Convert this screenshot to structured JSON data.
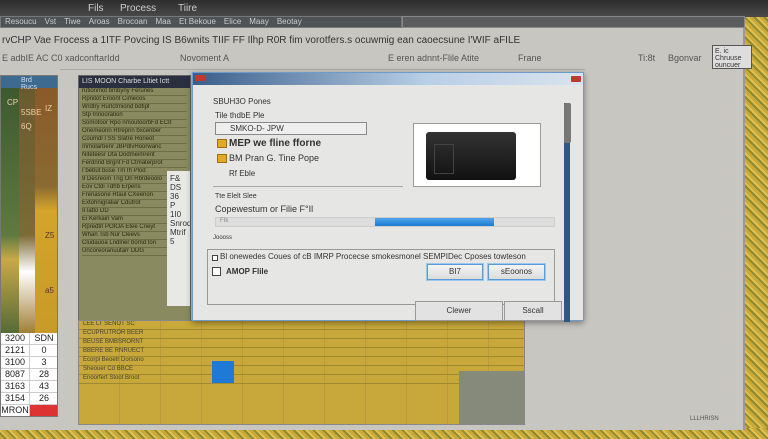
{
  "menu": {
    "items": [
      "Fils",
      "Process",
      "Tiire"
    ]
  },
  "toolbar": {
    "items": [
      "Resoucu",
      "Vst",
      "Tiwe",
      "Aroas",
      "Brocoan",
      "Maa",
      "Et Bekoue",
      "Elice",
      "Maay",
      "Beotay"
    ]
  },
  "header": {
    "title": "rvCHP Vae Frocess a 1ITF Povcing IS B6wnits TIIF FF Ilhp R0R fim vorotfers.s ocuwmig ean caoecsune I'WIF aFILE",
    "row": [
      "E adbIE AC C0 xadconftarIdd",
      "Novoment A",
      "E  eren adnnt-Flile  Atite",
      "Frane",
      "Ti:8t",
      "Bgonvar"
    ],
    "box_text": "E. ic Chruuse ouncuer tesclea"
  },
  "left_panel": {
    "head": "Brd Rucs",
    "cells": [
      "CP",
      "5SBE",
      "IZ",
      "6Q",
      "Z5",
      "a5"
    ],
    "table": [
      [
        "3200",
        "SDN"
      ],
      [
        "2121",
        "0"
      ],
      [
        "3100",
        "3"
      ],
      [
        "8087",
        "28"
      ],
      [
        "3163",
        "43"
      ],
      [
        "3154",
        "26"
      ],
      [
        "MRON",
        ""
      ]
    ]
  },
  "mid_panel": {
    "head": "LIS MOON  Charbe Lltiet  Ictt",
    "lines": [
      "rutionmot bmbyny Ferunes",
      "Rpnitot Eroont  Cimecos",
      "Wrdtry Rurlctmiond bdfipf",
      "Stp Innooration",
      "Somotoor Rpo nmoutoorbFd ECIt",
      "Onemeonn  Rtrepnn bxcenber",
      "Coumdl I  SS  Slatre Rorieot",
      "Inmolarbenr JBPdlvHoorwanc",
      "Niteteesr  Dta Dodmeimrent",
      "Ferdnnd Brgnt Fd Ctmaterprot",
      "I bebut buse Tm Ih Plod",
      "9 Desreoin Tng On Rbrdeoolo",
      "Eov Ctdi Tdhb Erpens",
      "Frenasone Rtaul  CXeenon",
      "Extohnigratiar Cdutrot",
      "IITatto DD",
      "Ei Kerkain Vam",
      "Rpredtrl  POIOA Etee Cneyt",
      "Whan Tsb Nur  Cleevs",
      "Cludauoa Lndlner bomd ton",
      "Uncoreoranuutarr DDG"
    ],
    "side": [
      "F&",
      "DS",
      "36",
      "P",
      "1I0",
      "Snrod",
      "Mtrif",
      "5"
    ]
  },
  "bottom_area": {
    "rows": [
      "LEE LT SENOT SC",
      "ECUPRUTROR BEER",
      "BEUSE BMBSRORNT",
      "BBERE BE RNRUECT",
      "Ecorpl Beoetr  Dorsono",
      "Sheouer Cd BBCE",
      "Enoorfert Stoot Broot"
    ]
  },
  "dialog": {
    "group_label": "SBUH3O Pones",
    "file_label": "Tile thdbE Ple",
    "file_value": "SMKO-D- JPW",
    "options": [
      "MEP we fline fforne",
      "BM Pran G. Tine Pope",
      "Rf Eble"
    ],
    "size_label": "Tte Elelt Slee",
    "progress_label": "Copewestum or Filie F°Il",
    "progress_sub": "FIk",
    "progress_fraction": 0.41,
    "section": "Joooss",
    "check1": "Bl onewedes Coues of cB IMRP Procecse smokesmonel SEMPIDec Cposes towteson",
    "check2": "AMOP Flile",
    "btn_ok": "BI7",
    "btn_other": "sEoonos",
    "btn_clear": "Clewer",
    "btn_send": "Sscall"
  },
  "status": "LLLHRISN"
}
